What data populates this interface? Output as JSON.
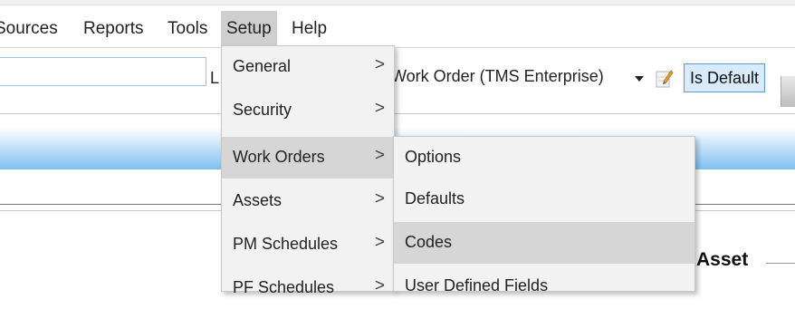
{
  "menubar": {
    "items": [
      {
        "label": "Sources"
      },
      {
        "label": "Reports"
      },
      {
        "label": "Tools"
      },
      {
        "label": "Setup"
      },
      {
        "label": "Help"
      }
    ]
  },
  "toolbar": {
    "search_value": "",
    "l_label": "L",
    "work_order_select": "Work Order (TMS Enterprise)",
    "is_default_label": "Is Default"
  },
  "section": {
    "asset_label": "Asset"
  },
  "setup_menu": {
    "items": [
      {
        "label": "General",
        "arrow": ">"
      },
      {
        "label": "Security",
        "arrow": ">"
      },
      {
        "label": "Work Orders",
        "arrow": ">"
      },
      {
        "label": "Assets",
        "arrow": ">"
      },
      {
        "label": "PM Schedules",
        "arrow": ">"
      },
      {
        "label": "PF Schedules",
        "arrow": ">"
      }
    ]
  },
  "work_orders_submenu": {
    "items": [
      {
        "label": "Options"
      },
      {
        "label": "Defaults"
      },
      {
        "label": "Codes"
      },
      {
        "label": "User Defined Fields"
      }
    ]
  },
  "colors": {
    "menu_highlight": "#d6d6d6",
    "is_default_bg": "#d9ebfb",
    "band_blue": "#7fbfee"
  }
}
